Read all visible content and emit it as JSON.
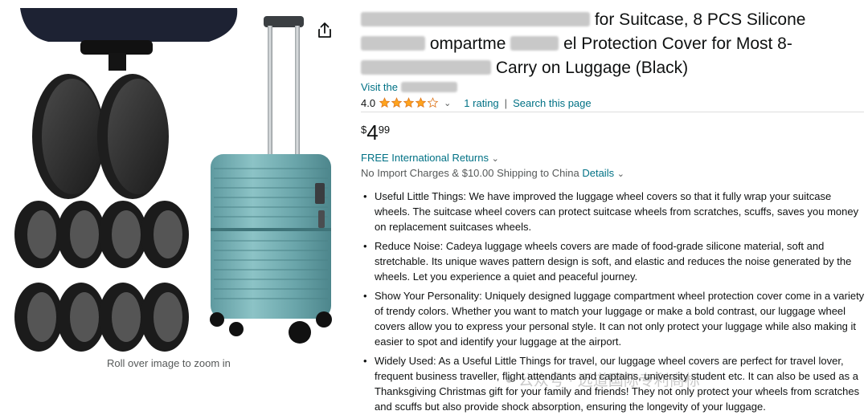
{
  "product": {
    "title_part1": "for Suitcase, 8 PCS Silicone",
    "title_part2": "ompartme",
    "title_part3": "el Protection Cover for Most 8-",
    "title_part4": "Carry on Luggage (Black)",
    "brand_link": "Visit the",
    "rating_value": "4.0",
    "rating_stars": 4,
    "rating_count": "1 rating",
    "search_page": "Search this page",
    "price_symbol": "$",
    "price_whole": "4",
    "price_fraction": "99",
    "returns": "FREE International Returns",
    "shipping_text": "No Import Charges & $10.00 Shipping to China",
    "shipping_details": "Details",
    "zoom_hint": "Roll over image to zoom in",
    "bullets": [
      "Useful Little Things: We have improved the luggage wheel covers so that it fully wrap your suitcase wheels. The suitcase wheel covers can protect suitcase wheels from scratches, scuffs, saves you money on replacement suitcases wheels.",
      "Reduce Noise: Cadeya luggage wheels covers are made of food-grade silicone material, soft and stretchable. Its unique waves pattern design is soft, and elastic and reduces the noise generated by the wheels. Let you experience a quiet and peaceful journey.",
      "Show Your Personality: Uniquely designed luggage compartment wheel protection cover come in a variety of trendy colors. Whether you want to match your luggage or make a bold contrast, our luggage wheel covers allow you to express your personal style. It can not only protect your luggage while also making it easier to spot and identify your luggage at the airport.",
      "Widely Used: As a Useful Little Things for travel, our luggage wheel covers are perfect for travel lover, frequent business traveller, flight attendants and captains, university student etc. It can also be used as a Thanksgiving Christmas gift for your family and friends! They not only protect your wheels from scratches and scuffs but also provide shock absorption, ensuring the longevity of your luggage."
    ]
  },
  "watermark": "公众号 · 远道国际专利商标",
  "colors": {
    "link": "#007185",
    "star": "#ffa41c",
    "text": "#0f1111",
    "muted": "#565959",
    "suitcase": "#7fb3b7"
  }
}
